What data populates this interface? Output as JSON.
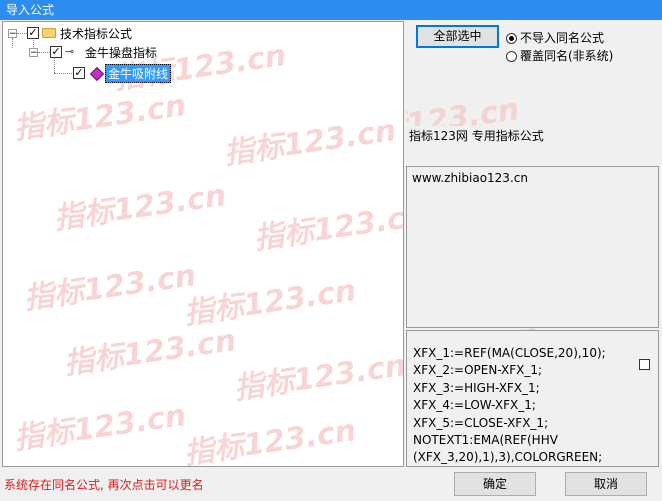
{
  "window": {
    "title": "导入公式"
  },
  "tree": {
    "items": [
      {
        "label": "技术指标公式",
        "checked": true,
        "icon": "folder-icon",
        "expander": "−"
      },
      {
        "label": "金牛操盘指标",
        "checked": true,
        "icon": "key-icon",
        "expander": "−"
      },
      {
        "label": "金牛吸附线",
        "checked": true,
        "icon": "diamond-icon",
        "selected": true
      }
    ]
  },
  "watermark": {
    "text": "指标123.cn"
  },
  "buttons": {
    "select_all": "全部选中",
    "ok": "确定",
    "cancel": "取消"
  },
  "options": [
    {
      "label": "不导入同名公式",
      "checked": true
    },
    {
      "label": "覆盖同名(非系统)",
      "checked": false
    }
  ],
  "info": {
    "description": "指标123网 专用指标公式",
    "url": "www.zhibiao123.cn"
  },
  "code": {
    "lines": [
      "XFX_1:=REF(MA(CLOSE,20),10);",
      "XFX_2:=OPEN-XFX_1;",
      "XFX_3:=HIGH-XFX_1;",
      "XFX_4:=LOW-XFX_1;",
      "XFX_5:=CLOSE-XFX_1;",
      "NOTEXT1:EMA(REF(HHV",
      "(XFX_3,20),1),3),COLORGREEN;"
    ]
  },
  "status": {
    "message": "系统存在同名公式, 再次点击可以更名"
  },
  "colors": {
    "titlebar": "#2d8cf0",
    "selection": "#3399ff",
    "status_text": "#e01b1b",
    "watermark": "#f5c8c8"
  }
}
